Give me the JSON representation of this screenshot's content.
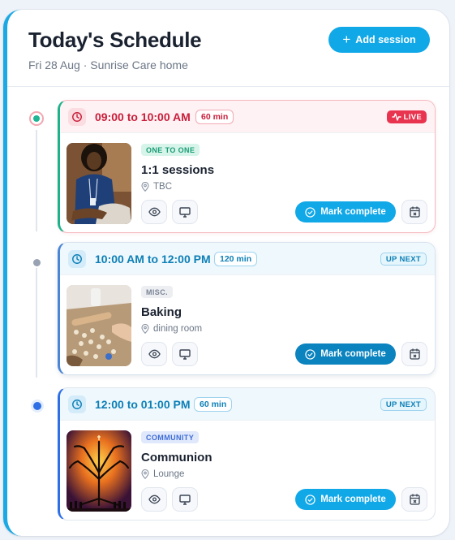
{
  "header": {
    "title": "Today's Schedule",
    "subtitle": "Fri 28 Aug · Sunrise Care home",
    "add_label": "Add session"
  },
  "sessions": [
    {
      "time": "09:00 to 10:00 AM",
      "duration": "60 min",
      "status": "LIVE",
      "category": "ONE TO ONE",
      "name": "1:1 sessions",
      "location": "TBC",
      "mark_label": "Mark complete",
      "thumb": "person-portrait"
    },
    {
      "time": "10:00 AM to 12:00 PM",
      "duration": "120 min",
      "status": "UP NEXT",
      "category": "MISC.",
      "name": "Baking",
      "location": "dining room",
      "mark_label": "Mark complete",
      "thumb": "baking-cookies"
    },
    {
      "time": "12:00 to 01:00 PM",
      "duration": "60 min",
      "status": "UP NEXT",
      "category": "COMMUNITY",
      "name": "Communion",
      "location": "Lounge",
      "mark_label": "Mark complete",
      "thumb": "tree-of-life"
    }
  ],
  "icons": {
    "add": "plus-icon",
    "clock": "clock-icon",
    "live": "pulse-icon",
    "location": "map-pin-icon",
    "view": "eye-icon",
    "display": "monitor-icon",
    "check": "check-circle-icon",
    "calendar": "calendar-x-icon"
  },
  "colors": {
    "accent": "#11a8e8",
    "live": "#e8344f",
    "live_time": "#c81e3a",
    "next_time": "#0d7fb6",
    "mark_next": "#0a83bf"
  }
}
